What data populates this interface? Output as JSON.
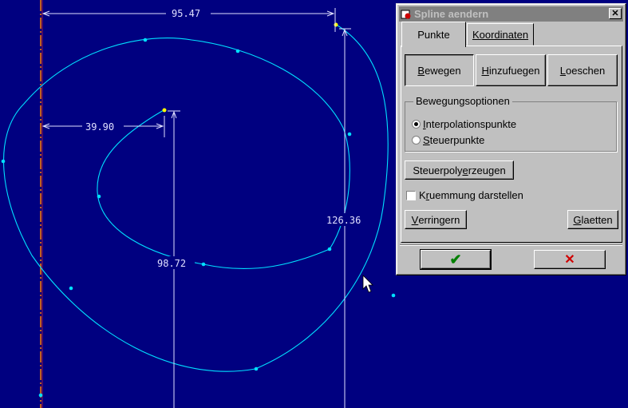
{
  "cad": {
    "dimensions": {
      "top_width": "95.47",
      "inner_offset": "39.90",
      "right_height": "126.36",
      "inner_height": "98.72"
    },
    "colors": {
      "background": "#000080",
      "spline": "#00e0ff",
      "dimension": "#e0e0ff",
      "axis": "#ff8000",
      "endpoint": "#ffff00"
    }
  },
  "dialog": {
    "title": "Spline aendern",
    "close_glyph": "✕",
    "tabs": [
      {
        "label": "Punkte",
        "active": true
      },
      {
        "label": "Koordinaten",
        "active": false
      }
    ],
    "mode_buttons": {
      "move": {
        "pre": "",
        "key": "B",
        "post": "ewegen",
        "pressed": true
      },
      "add": {
        "pre": "",
        "key": "H",
        "post": "inzufuegen",
        "pressed": false
      },
      "delete": {
        "pre": "",
        "key": "L",
        "post": "oeschen",
        "pressed": false
      }
    },
    "options_group": {
      "legend": "Bewegungsoptionen",
      "interp": {
        "key": "I",
        "post": "nterpolationspunkte",
        "checked": true
      },
      "control": {
        "key": "S",
        "post": "teuerpunkte",
        "checked": false
      }
    },
    "ctrlpoly_button": {
      "pre": "Steuerpoly ",
      "key": "e",
      "post": "rzeugen"
    },
    "curvature_check": {
      "pre": "K",
      "key": "r",
      "post": "uemmung darstellen",
      "checked": false
    },
    "reduce_button": {
      "key": "V",
      "post": "erringern"
    },
    "smooth_button": {
      "key": "G",
      "post": "laetten"
    },
    "ok_glyph": "✔",
    "cancel_glyph": "✕"
  }
}
